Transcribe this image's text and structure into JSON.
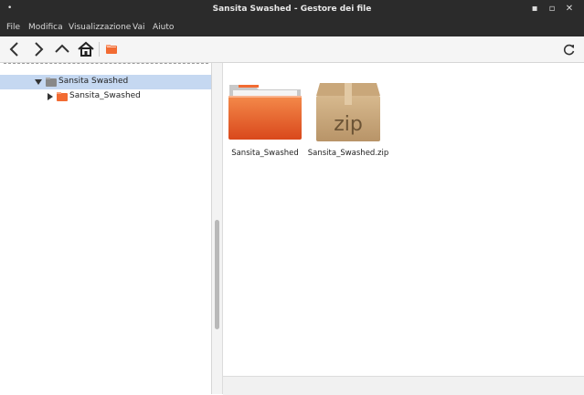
{
  "window": {
    "title": "Sansita Swashed - Gestore dei file"
  },
  "menu": {
    "items": [
      "File",
      "Modifica",
      "Visualizzazione",
      "Vai",
      "Aiuto"
    ]
  },
  "sidebar": {
    "tree": [
      {
        "label": "Sansita Swashed",
        "expanded": true,
        "selected": true
      },
      {
        "label": "Sansita_Swashed",
        "expanded": false,
        "selected": false
      }
    ]
  },
  "files": [
    {
      "name": "Sansita_Swashed",
      "icon": "folder-icon"
    },
    {
      "name": "Sansita_Swashed.zip",
      "icon": "zip-archive-icon",
      "badge": "zip"
    }
  ],
  "colors": {
    "titlebar": "#2b2b2b",
    "selection": "#c5d8f1",
    "folder": "#f26b32"
  }
}
